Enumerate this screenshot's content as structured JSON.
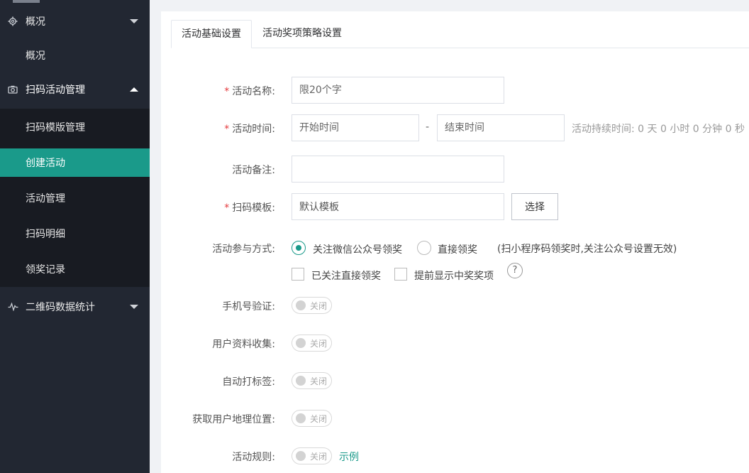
{
  "sidebar": {
    "groups": [
      {
        "label": "概况",
        "icon": "gear-icon"
      },
      {
        "label": "扫码活动管理",
        "icon": "camera-icon"
      },
      {
        "label": "二维码数据统计",
        "icon": "pulse-icon"
      }
    ],
    "overview_sub": "概况",
    "scan_items": [
      {
        "label": "扫码模版管理"
      },
      {
        "label": "创建活动"
      },
      {
        "label": "活动管理"
      },
      {
        "label": "扫码明细"
      },
      {
        "label": "领奖记录"
      }
    ],
    "active_item": "创建活动"
  },
  "tabs": [
    {
      "label": "活动基础设置",
      "active": true
    },
    {
      "label": "活动奖项策略设置",
      "active": false
    }
  ],
  "form": {
    "name": {
      "label": "活动名称:",
      "placeholder": "限20个字",
      "required": true
    },
    "time": {
      "label": "活动时间:",
      "start_placeholder": "开始时间",
      "end_placeholder": "结束时间",
      "separator": "-",
      "duration": "活动持续时间: 0 天 0 小时 0 分钟 0 秒",
      "required": true
    },
    "remark": {
      "label": "活动备注:",
      "value": ""
    },
    "template": {
      "label": "扫码模板:",
      "value": "默认模板",
      "select_label": "选择",
      "required": true
    },
    "participation": {
      "label": "活动参与方式:",
      "options": [
        "关注微信公众号领奖",
        "直接领奖"
      ],
      "selected": "关注微信公众号领奖",
      "note": "(扫小程序码领奖时,关注公众号设置无效)",
      "checkboxes": [
        "已关注直接领奖",
        "提前显示中奖奖项"
      ],
      "help": "?"
    },
    "phone_verify": {
      "label": "手机号验证:",
      "state": "关闭"
    },
    "user_info": {
      "label": "用户资料收集:",
      "state": "关闭"
    },
    "auto_tag": {
      "label": "自动打标签:",
      "state": "关闭"
    },
    "location": {
      "label": "获取用户地理位置:",
      "state": "关闭"
    },
    "rules": {
      "label": "活动规则:",
      "state": "关闭",
      "example": "示例"
    }
  },
  "colors": {
    "accent": "#1a9a8a",
    "sidebar_bg": "#222732",
    "submenu_bg": "#181b22",
    "required": "#e4393c"
  }
}
